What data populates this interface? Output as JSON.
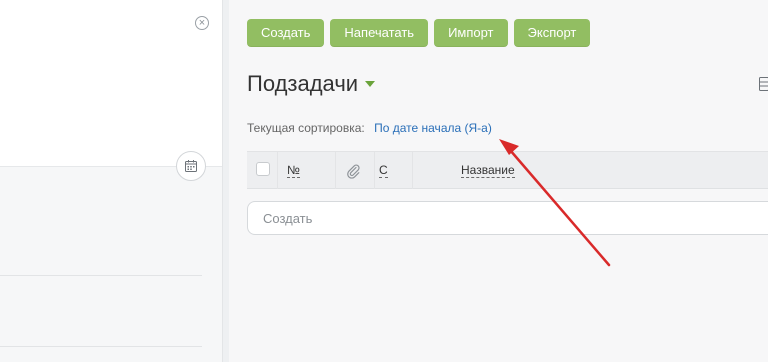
{
  "left_panel": {
    "close_icon": "close-icon",
    "calendar_icon": "calendar-icon"
  },
  "toolbar": {
    "create_label": "Создать",
    "print_label": "Напечатать",
    "import_label": "Импорт",
    "export_label": "Экспорт"
  },
  "main": {
    "title": "Подзадачи",
    "sort_prefix": "Текущая сортировка:",
    "sort_value": "По дате начала (Я-а)"
  },
  "table": {
    "columns": [
      "№",
      "С",
      "Название"
    ],
    "attachment_icon": "paperclip-icon"
  },
  "create_field": {
    "placeholder": "Создать",
    "value": ""
  },
  "colors": {
    "button_bg": "#92be62",
    "link": "#2a6fb8",
    "annotation_arrow": "#d92a2a"
  }
}
